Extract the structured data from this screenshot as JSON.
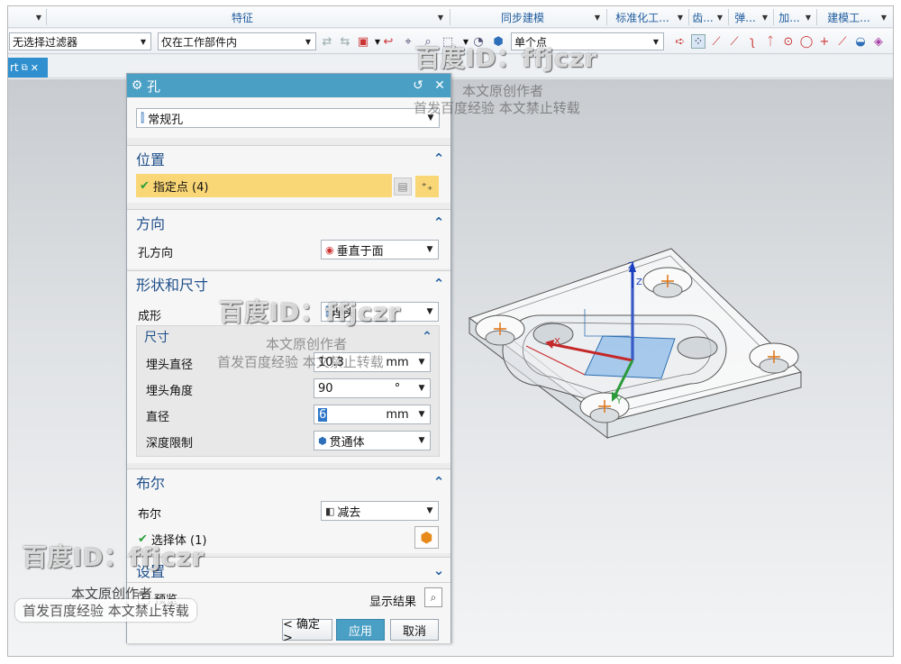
{
  "toolbar_top": {
    "groups": [
      "特征",
      "同步建模",
      "标准化工...",
      "齿...",
      "弹...",
      "加...",
      "建模工..."
    ]
  },
  "toolbar_filters": {
    "type_filter": "无选择过滤器",
    "scope_filter": "仅在工作部件内",
    "point_type": "单个点"
  },
  "tab": {
    "label": "rt"
  },
  "dialog": {
    "title": "孔",
    "hole_type": "常规孔",
    "sections": {
      "position": {
        "header": "位置",
        "specify_point": "指定点 (4)"
      },
      "direction": {
        "header": "方向",
        "hole_direction_label": "孔方向",
        "hole_direction_value": "垂直于面"
      },
      "shape": {
        "header": "形状和尺寸",
        "form_label": "成形",
        "form_value": "埋头",
        "dims_header": "尺寸",
        "countersink_diameter_label": "埋头直径",
        "countersink_diameter_value": "10.3",
        "countersink_diameter_unit": "mm",
        "countersink_angle_label": "埋头角度",
        "countersink_angle_value": "90",
        "countersink_angle_unit": "°",
        "diameter_label": "直径",
        "diameter_value": "6",
        "diameter_unit": "mm",
        "depth_limit_label": "深度限制",
        "depth_limit_value": "贯通体"
      },
      "boolean": {
        "header": "布尔",
        "boolean_label": "布尔",
        "boolean_value": "减去",
        "select_body": "选择体 (1)"
      },
      "settings": {
        "header": "设置"
      }
    },
    "preview_label": "预览",
    "show_result_label": "显示结果",
    "ok_button": "< 确定 >",
    "apply_button": "应用",
    "cancel_button": "取消"
  },
  "viewport": {
    "axis_labels": {
      "z": "Z",
      "y": "Y",
      "x": "X",
      "zc": "Z"
    }
  },
  "watermarks": {
    "id_text": "百度ID：ffjczr",
    "author_text": "本文原创作者",
    "notice_text": "首发百度经验  本文禁止转载"
  },
  "colors": {
    "dialog_title_bar": "#4a9fc4",
    "section_header_text": "#1e4f8a",
    "selected_row": "#fad776",
    "tab_active": "#2f8fcf"
  }
}
